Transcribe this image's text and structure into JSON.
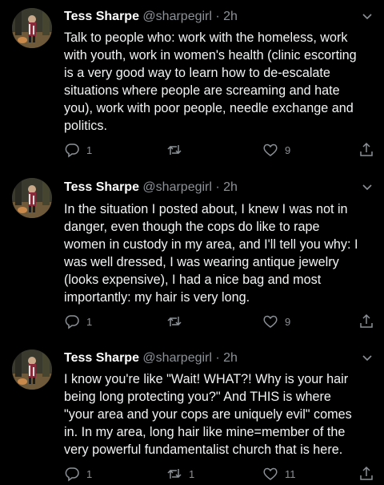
{
  "tweets": [
    {
      "name": "Tess Sharpe",
      "handle": "@sharpegirl",
      "sep": "·",
      "time": "2h",
      "lines": [
        "Talk to people who: work with the homeless, work",
        "with youth, work in women's health (clinic escorting",
        "is a very good way to learn how to de-escalate",
        "situations where people are screaming and hate",
        "you), work with poor people, needle exchange and",
        "politics."
      ],
      "replies": "1",
      "retweets": "",
      "likes": "9"
    },
    {
      "name": "Tess Sharpe",
      "handle": "@sharpegirl",
      "sep": "·",
      "time": "2h",
      "lines": [
        "In the situation I posted about, I knew I was not in",
        "danger, even though the cops do like to rape",
        "women in custody in my area, and I'll tell you why: I",
        "was well dressed, I was wearing antique jewelry",
        "(looks expensive), I had a nice bag and most",
        "importantly: my hair is very long."
      ],
      "replies": "1",
      "retweets": "",
      "likes": "9"
    },
    {
      "name": "Tess Sharpe",
      "handle": "@sharpegirl",
      "sep": "·",
      "time": "2h",
      "lines": [
        "I know you're like \"Wait! WHAT?! Why is your hair",
        "being long protecting you?\" And THIS is where",
        "\"your area and your cops are uniquely evil\" comes",
        "in. In my area, long hair like mine=member of the",
        "very powerful fundamentalist church that is here."
      ],
      "replies": "1",
      "retweets": "1",
      "likes": "11"
    }
  ],
  "icons": {
    "reply": "reply-icon",
    "retweet": "retweet-icon",
    "like": "heart-icon",
    "share": "share-icon",
    "more": "chevron-down-icon"
  },
  "colors": {
    "background": "#000000",
    "text": "#e7e9ea",
    "muted": "#8b9197"
  }
}
